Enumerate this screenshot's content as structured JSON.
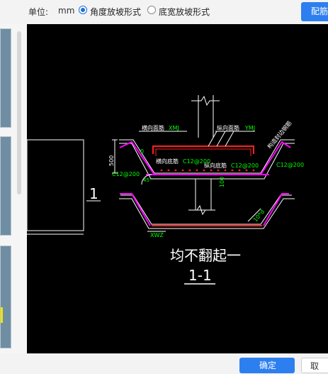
{
  "toolbar": {
    "unit_label": "单位:",
    "unit_value": "mm",
    "option_angle": "角度放坡形式",
    "option_width": "底宽放坡形式",
    "selected": "option_angle",
    "config_button": "配筋"
  },
  "footer": {
    "ok_button": "确定",
    "cancel_button": "取"
  },
  "drawing": {
    "label_transverse_top": "横向面筋",
    "label_transverse_top_code": "XMJ",
    "label_longitudinal_top": "纵向面筋",
    "label_longitudinal_top_code": "YMJ",
    "label_construction": "构造封边钢筋",
    "label_transverse_bottom": "横向底筋",
    "label_transverse_bottom_spec": "C12@200",
    "label_longitudinal_bottom": "纵向底筋",
    "label_longitudinal_bottom_spec": "C12@200",
    "spec_left": "C12@200",
    "spec_right": "C12@200",
    "dim_500": "500",
    "dim_0": "0",
    "dim_45": "45°",
    "dim_100": "100",
    "dim_xwz": "XWZ",
    "dim_diag": "10*d",
    "section_title": "均不翻起一",
    "section_number": "1-1",
    "side_marker": "1"
  },
  "colors": {
    "canvas_bg": "#000000",
    "structure": "#ffffff",
    "rebar_red": "#ff2020",
    "rebar_magenta": "#ff00ff",
    "label_green": "#00ff00",
    "label_yellow": "#ffff00",
    "accent_blue": "#2d7ff0"
  }
}
